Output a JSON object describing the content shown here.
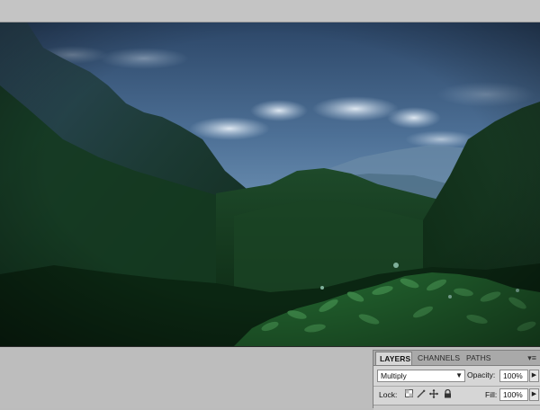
{
  "layers_panel": {
    "tabs": [
      {
        "label": "LAYERS",
        "active": true
      },
      {
        "label": "CHANNELS",
        "active": false
      },
      {
        "label": "PATHS",
        "active": false
      }
    ],
    "menu_icon": "panel-menu-icon",
    "blend_mode": "Multiply",
    "opacity_label": "Opacity:",
    "opacity_value": "100%",
    "lock_label": "Lock:",
    "fill_label": "Fill:",
    "fill_value": "100%",
    "lock_icons": [
      "lock-transparent-icon",
      "lock-image-icon",
      "lock-position-icon",
      "lock-all-icon"
    ]
  },
  "colors": {
    "workspace": "#bcbcbc",
    "panel": "#d6d6d6",
    "sky": "#4d7096",
    "forest": "#123818"
  }
}
